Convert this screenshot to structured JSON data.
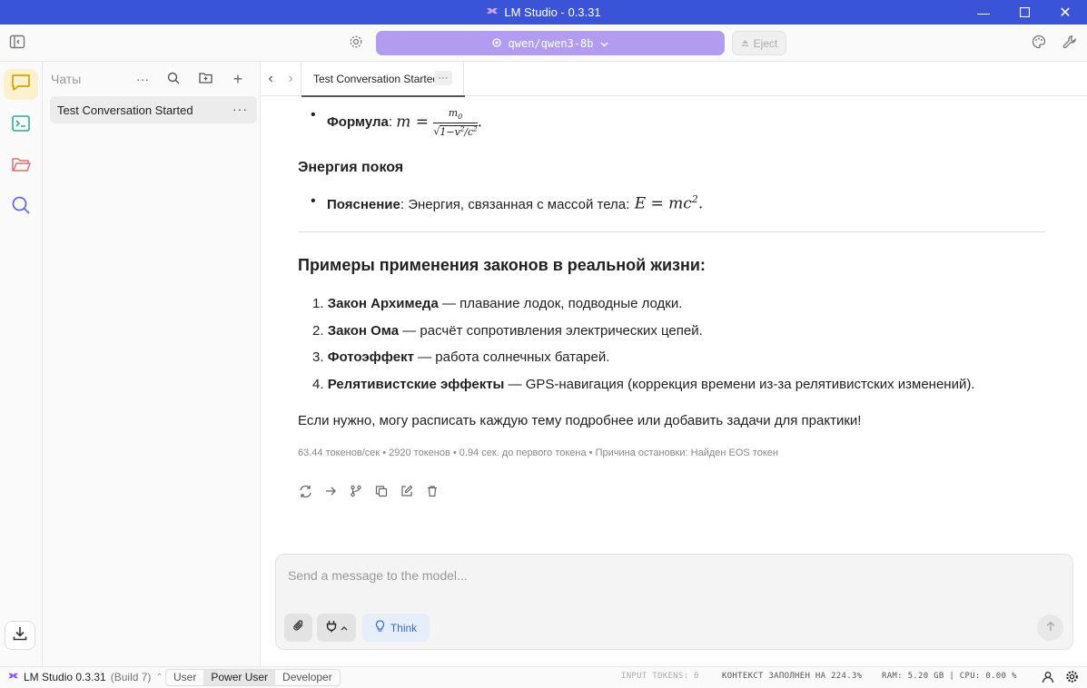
{
  "window": {
    "title": "LM Studio - 0.3.31"
  },
  "toolbar": {
    "model_name": "qwen/qwen3-8b",
    "eject_label": "Eject"
  },
  "sidebar": {
    "title": "Чаты",
    "chats": [
      {
        "title": "Test Conversation Started"
      }
    ]
  },
  "tabs": [
    {
      "label": "Test Conversation Started"
    }
  ],
  "message": {
    "formula_label": "Формула",
    "rest_energy_heading": "Энергия покоя",
    "explanation_label": "Пояснение",
    "explanation_text": ": Энергия, связанная с массой тела: ",
    "examples_heading": "Примеры применения законов в реальной жизни:",
    "examples": [
      {
        "num": "1.",
        "title": "Закон Архимеда",
        "text": " — плавание лодок, подводные лодки."
      },
      {
        "num": "2.",
        "title": "Закон Ома",
        "text": " — расчёт сопротивления электрических цепей."
      },
      {
        "num": "3.",
        "title": "Фотоэффект",
        "text": " — работа солнечных батарей."
      },
      {
        "num": "4.",
        "title": "Релятивистские эффекты",
        "text": " — GPS-навигация (коррекция времени из-за релятивистских изменений)."
      }
    ],
    "closing": "Если нужно, могу расписать каждую тему подробнее или добавить задачи для практики!",
    "stats": "63.44 токенов/сек • 2920 токенов • 0.94 сек. до первого токена • Причина остановки: Найден EOS токен"
  },
  "composer": {
    "placeholder": "Send a message to the model...",
    "think_label": "Think"
  },
  "statusbar": {
    "app_name": "LM Studio 0.3.31",
    "build": "(Build 7)",
    "modes": [
      "User",
      "Power User",
      "Developer"
    ],
    "active_mode": "Power User",
    "input_tokens": "INPUT TOKENS:  0",
    "context": "КОНТЕКСТ ЗАПОЛНЕН НА 224.3%",
    "ram_cpu": "RAM: 5.20 GB  |  CPU: 0.00 %"
  },
  "colors": {
    "titlebar": "#3b53d6",
    "model_pill": "#b19cf0",
    "active_rail": "#fbf1cf"
  }
}
